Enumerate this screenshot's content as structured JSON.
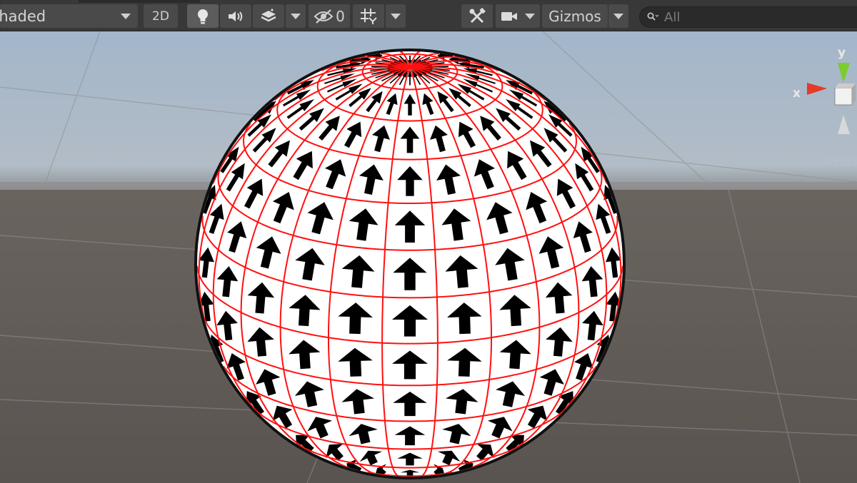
{
  "toolbar": {
    "draw_mode": "Shaded",
    "mode_2d": "2D",
    "hidden_count": "0",
    "gizmos_label": "Gizmos",
    "search_placeholder": "All",
    "icons": [
      "light-bulb-icon",
      "speaker-icon",
      "fx-layers-icon",
      "eye-slash-icon",
      "grid-icon",
      "tools-icon",
      "camera-icon",
      "search-icon"
    ]
  },
  "viewport": {
    "orientation_gizmo": {
      "y_label": "y",
      "x_label": "x",
      "projection": "Persp"
    },
    "colors": {
      "sky": "#a8b8cc",
      "ground": "#625b57",
      "sphere": "#ffffff",
      "grid_lines": "#ff0000",
      "arrows": "#000000",
      "axis_y": "#7ccc2c",
      "axis_x": "#e53a2a"
    }
  }
}
